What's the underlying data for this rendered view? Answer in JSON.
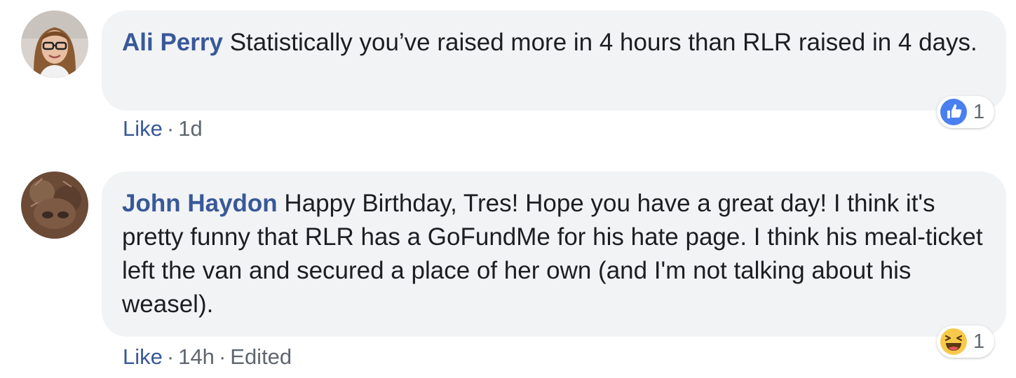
{
  "comments": [
    {
      "author": "Ali Perry",
      "text": "Statistically you’ve raised more in 4 hours than RLR raised in 4 days.",
      "like_label": "Like",
      "time": "1d",
      "edited_label": "",
      "reaction": {
        "icon": "like-icon",
        "color": "#4a7ff0",
        "count": "1"
      }
    },
    {
      "author": "John Haydon",
      "text": "Happy Birthday, Tres! Hope you have a great day! I think it's pretty funny that RLR has a GoFundMe for his hate page. I think his meal-ticket left the van and secured a place of her own (and I'm not talking about his weasel).",
      "like_label": "Like",
      "time": "14h",
      "edited_label": "Edited",
      "reaction": {
        "icon": "haha-icon",
        "color": "#f7c94a",
        "count": "1"
      }
    }
  ],
  "colors": {
    "author": "#385898",
    "bubble": "#f2f3f5",
    "meta": "#606770"
  }
}
